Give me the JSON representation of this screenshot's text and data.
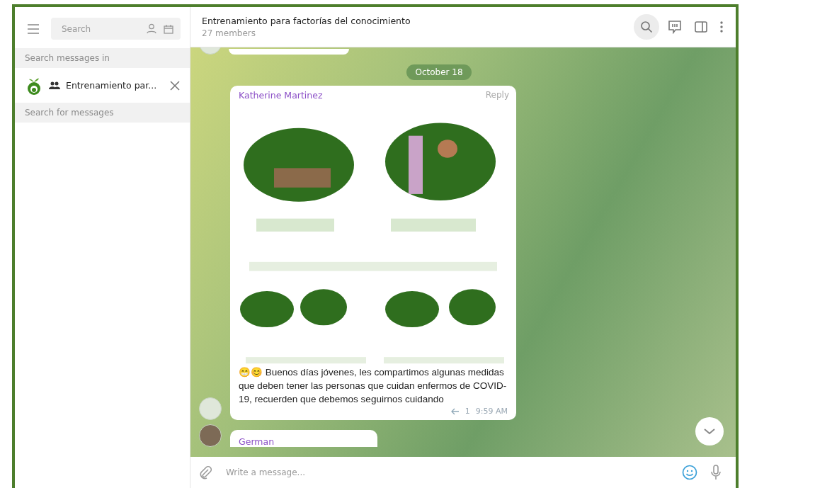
{
  "sidebar": {
    "search": {
      "placeholder": "Search"
    },
    "section_label": "Search messages in",
    "chat": {
      "name": "Entrenamiento par..."
    },
    "message_search": {
      "placeholder": "Search for messages"
    }
  },
  "header": {
    "title": "Entrenamiento para factorías del conocimiento",
    "subtitle": "27 members",
    "search_active": true
  },
  "date_badge": "October 18",
  "messages": [
    {
      "kind": "stub"
    },
    {
      "author": "Katherine Martinez",
      "action": "Reply",
      "emoji": "😁😊",
      "text": "Buenos días jóvenes, les compartimos algunas medidas que deben tener las personas que cuidan enfermos de COVID-19, recuerden que debemos seguirnos cuidando",
      "replies": "1",
      "time": "9:59 AM"
    },
    {
      "kind": "cut",
      "author": "German"
    }
  ],
  "composer": {
    "placeholder": "Write a message..."
  }
}
